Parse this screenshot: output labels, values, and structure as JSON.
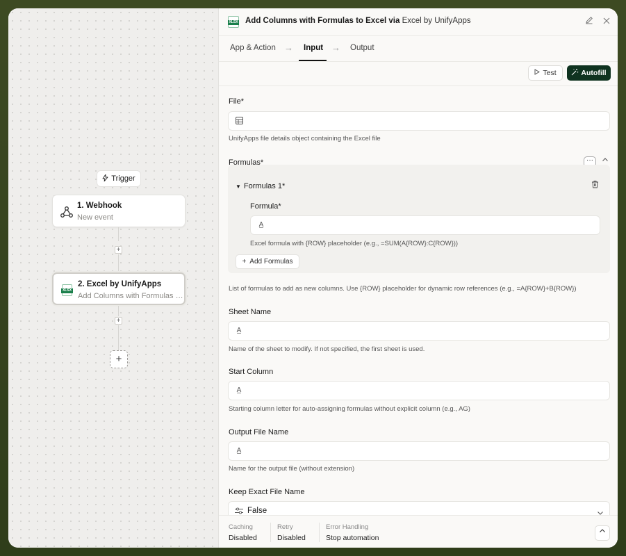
{
  "canvas": {
    "trigger_label": "Trigger",
    "nodes": [
      {
        "title": "1. Webhook",
        "subtitle": "New event"
      },
      {
        "title": "2. Excel by UnifyApps",
        "subtitle": "Add Columns with Formulas to Excel"
      }
    ]
  },
  "panel": {
    "title": "Add Columns with Formulas to Excel via",
    "app_name": "Excel by UnifyApps",
    "badge": "XLSX",
    "tabs": [
      "App & Action",
      "Input",
      "Output"
    ],
    "active_tab": "Input",
    "test_label": "Test",
    "autofill_label": "Autofill",
    "fields": {
      "file": {
        "label": "File*",
        "help": "UnifyApps file details object containing the Excel file"
      },
      "formulas": {
        "label": "Formulas*",
        "help": "List of formulas to add as new columns. Use {ROW} placeholder for dynamic row references (e.g., =A{ROW}+B{ROW})"
      },
      "formulas_item": {
        "label": "Formulas 1*"
      },
      "formula": {
        "label": "Formula*",
        "help": "Excel formula with {ROW} placeholder (e.g., =SUM(A{ROW}:C{ROW}))"
      },
      "add_formulas": "Add Formulas",
      "sheet_name": {
        "label": "Sheet Name",
        "help": "Name of the sheet to modify. If not specified, the first sheet is used."
      },
      "start_column": {
        "label": "Start Column",
        "help": "Starting column letter for auto-assigning formulas without explicit column (e.g., AG)"
      },
      "output_file_name": {
        "label": "Output File Name",
        "help": "Name for the output file (without extension)"
      },
      "keep_exact": {
        "label": "Keep Exact File Name",
        "value": "False"
      }
    },
    "footer": {
      "caching": {
        "key": "Caching",
        "value": "Disabled"
      },
      "retry": {
        "key": "Retry",
        "value": "Disabled"
      },
      "error": {
        "key": "Error Handling",
        "value": "Stop automation"
      }
    }
  },
  "colors": {
    "accent": "#0f3320",
    "excel_green": "#1a7f4b",
    "frame": "#3d4a22"
  }
}
